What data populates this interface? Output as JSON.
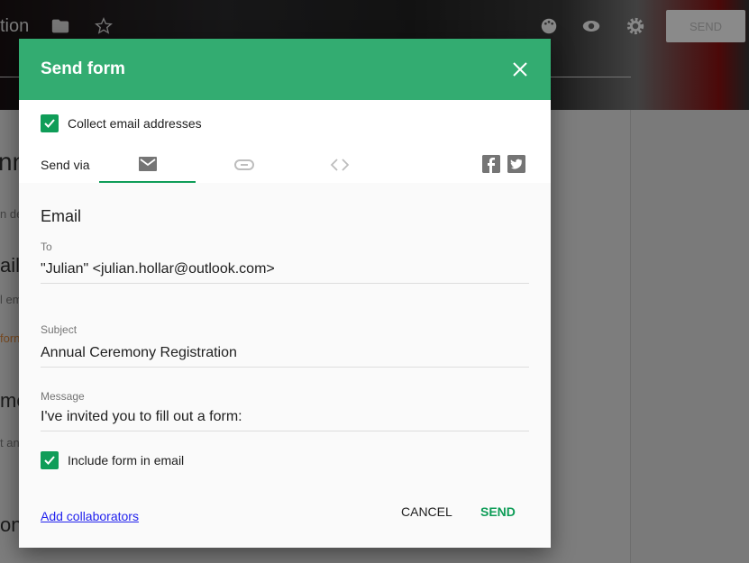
{
  "topbar": {
    "title_fragment": "tion",
    "send_label": "SEND",
    "icons": [
      "folder-icon",
      "star-icon",
      "palette-icon",
      "eye-icon",
      "gear-icon"
    ]
  },
  "background": {
    "fragments": [
      "nn",
      "n de",
      "ail",
      "l em",
      "forn",
      "me",
      "t an",
      "one"
    ]
  },
  "dialog": {
    "title": "Send form",
    "collect_label": "Collect email addresses",
    "collect_checked": true,
    "send_via_label": "Send via",
    "tabs": [
      "email-icon",
      "link-icon",
      "embed-icon"
    ],
    "active_tab": "email-icon",
    "share_icons": [
      "facebook-icon",
      "twitter-icon"
    ],
    "section_title": "Email",
    "to_label": "To",
    "to_value": "\"Julian\" <julian.hollar@outlook.com>",
    "subject_label": "Subject",
    "subject_value": "Annual Ceremony Registration",
    "message_label": "Message",
    "message_value": "I've invited you to fill out a form:",
    "include_label": "Include form in email",
    "include_checked": true,
    "collaborators_link": "Add collaborators",
    "cancel_label": "CANCEL",
    "send_label": "SEND"
  },
  "colors": {
    "header": "#33ac71",
    "accent": "#0f9d58"
  }
}
